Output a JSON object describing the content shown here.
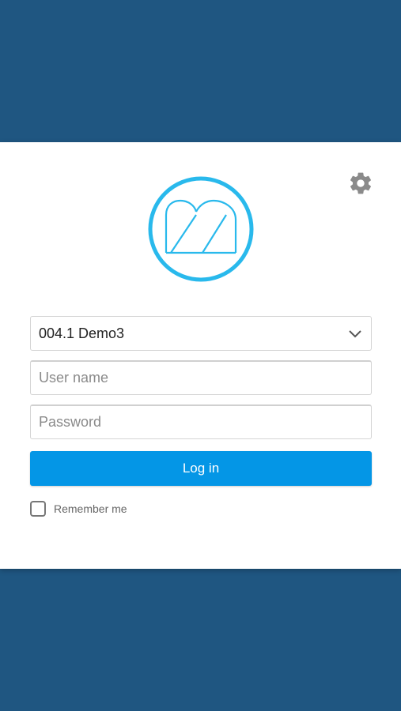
{
  "colors": {
    "background": "#1f5681",
    "card": "#ffffff",
    "accent": "#0496e6",
    "logo": "#29b9ec",
    "gear": "#8a8a8a"
  },
  "settings": {
    "icon": "gear-icon"
  },
  "logo": {
    "icon": "app-logo"
  },
  "form": {
    "server_select": {
      "value": "004.1 Demo3"
    },
    "username": {
      "placeholder": "User name",
      "value": ""
    },
    "password": {
      "placeholder": "Password",
      "value": ""
    },
    "login_label": "Log in",
    "remember_label": "Remember me",
    "remember_checked": false
  }
}
